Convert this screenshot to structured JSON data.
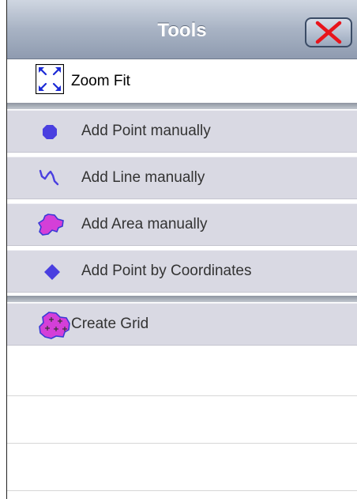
{
  "header": {
    "title": "Tools"
  },
  "tools": {
    "zoom_fit": "Zoom Fit",
    "add_point": "Add Point manually",
    "add_line": "Add Line manually",
    "add_area": "Add Area manually",
    "add_point_coords": "Add Point by Coordinates",
    "create_grid": "Create Grid"
  },
  "icons": {
    "close": "close-x-icon",
    "zoom_fit": "zoom-fit-arrows-icon",
    "point": "point-circle-icon",
    "line": "line-squiggle-icon",
    "area": "area-shape-icon",
    "coordinates": "diamond-icon",
    "grid": "grid-area-icon"
  },
  "colors": {
    "accent_blue": "#4a3fe0",
    "area_magenta": "#d43fd8",
    "close_red": "#e8141b",
    "row_bg": "#d9d9e3"
  }
}
